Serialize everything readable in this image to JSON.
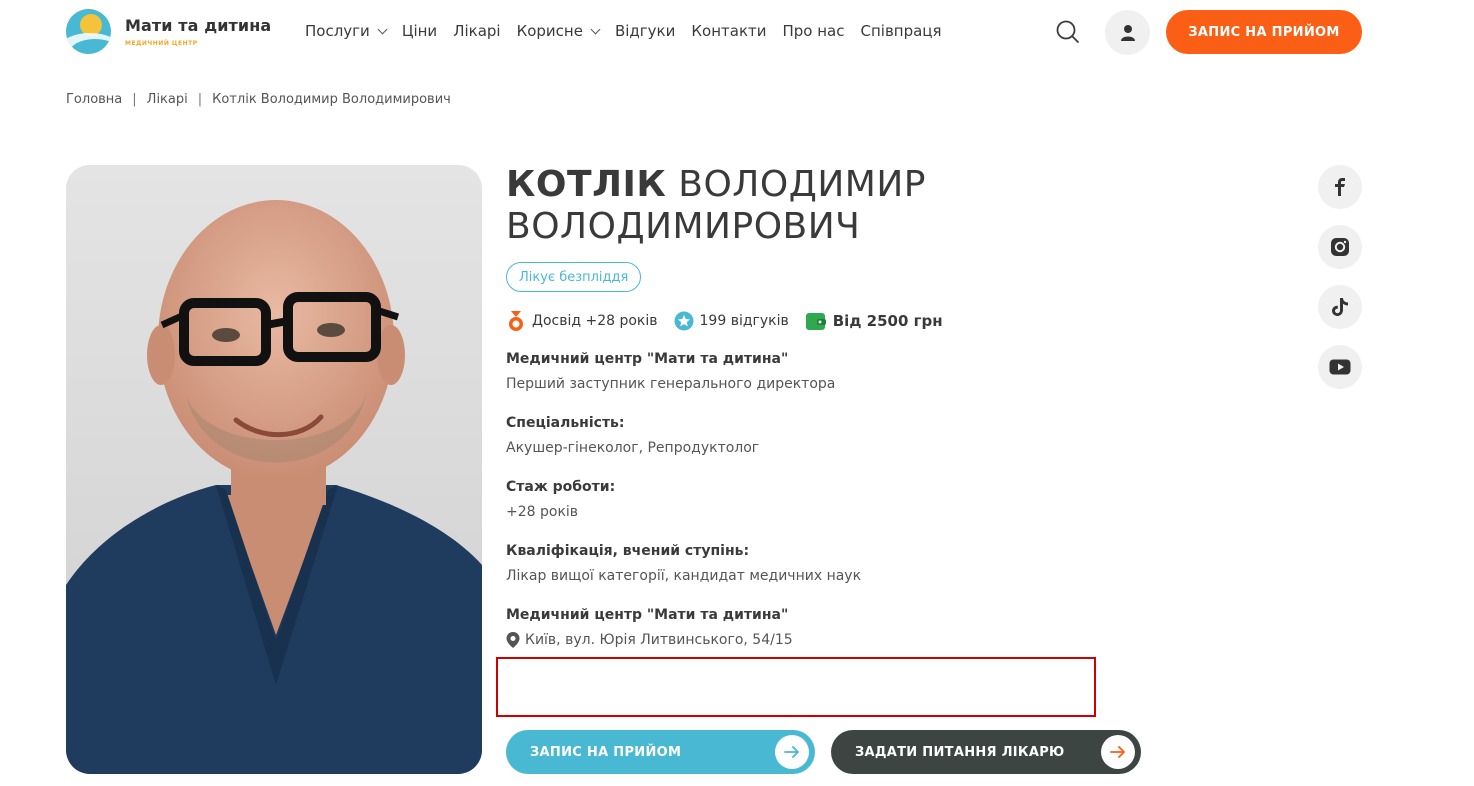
{
  "header": {
    "logo_title": "Мати та дитина",
    "logo_subtitle": "медичний центр",
    "nav": [
      {
        "label": "Послуги",
        "dropdown": true
      },
      {
        "label": "Ціни",
        "dropdown": false
      },
      {
        "label": "Лікарі",
        "dropdown": false
      },
      {
        "label": "Корисне",
        "dropdown": true
      },
      {
        "label": "Відгуки",
        "dropdown": false
      },
      {
        "label": "Контакти",
        "dropdown": false
      },
      {
        "label": "Про нас",
        "dropdown": false
      },
      {
        "label": "Співпраця",
        "dropdown": false
      }
    ],
    "cta": "ЗАПИС НА ПРИЙОМ"
  },
  "breadcrumb": {
    "home": "Головна",
    "doctors": "Лікарі",
    "current": "Котлік Володимир Володимирович"
  },
  "doctor": {
    "last_name": "КОТЛІК",
    "first_name": "ВОЛОДИМИР",
    "patronymic": "ВОЛОДИМИРОВИЧ",
    "tag": "Лікує безпліддя",
    "experience": "Досвід +28 років",
    "reviews": "199 відгуків",
    "price": "Від 2500 грн",
    "clinic_label": "Медичний центр \"Мати та дитина\"",
    "position": "Перший заступник генерального директора",
    "specialty_label": "Спеціальність:",
    "specialty": "Акушер-гінеколог, Репродуктолог",
    "tenure_label": "Стаж роботи:",
    "tenure": "+28 років",
    "qualification_label": "Кваліфікація, вчений ступінь:",
    "qualification": "Лікар вищої категорії, кандидат медичних наук",
    "location_label": "Медичний центр \"Мати та дитина\"",
    "address": "Київ, вул. Юрія Литвинського, 54/15"
  },
  "buttons": {
    "appoint": "ЗАПИС НА ПРИЙОМ",
    "ask": "ЗАДАТИ ПИТАННЯ ЛІКАРЮ"
  },
  "socials": [
    "facebook-icon",
    "instagram-icon",
    "tiktok-icon",
    "youtube-icon"
  ],
  "colors": {
    "accent_orange": "#fb5e15",
    "accent_blue": "#49b9d3",
    "dark_button": "#3d4543",
    "highlight_border": "#d00000"
  }
}
